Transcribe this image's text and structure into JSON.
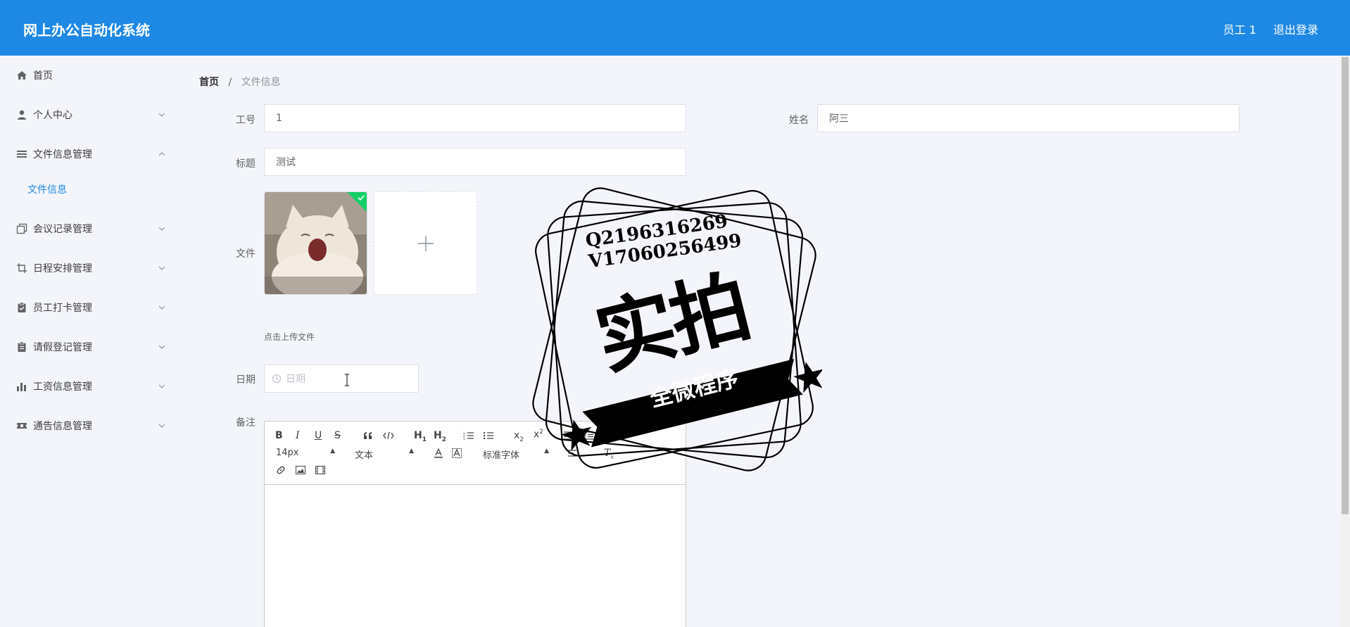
{
  "header": {
    "app_title": "网上办公自动化系统",
    "user_label": "员工 1",
    "logout_label": "退出登录"
  },
  "sidebar": {
    "items": [
      {
        "label": "首页",
        "icon": "home-icon",
        "expandable": false
      },
      {
        "label": "个人中心",
        "icon": "user-icon",
        "expandable": true
      },
      {
        "label": "文件信息管理",
        "icon": "list-icon",
        "expandable": true,
        "expanded": true
      },
      {
        "label": "会议记录管理",
        "icon": "copy-icon",
        "expandable": true
      },
      {
        "label": "日程安排管理",
        "icon": "crop-icon",
        "expandable": true
      },
      {
        "label": "员工打卡管理",
        "icon": "clipboard-check-icon",
        "expandable": true
      },
      {
        "label": "请假登记管理",
        "icon": "clipboard-icon",
        "expandable": true
      },
      {
        "label": "工资信息管理",
        "icon": "bar-chart-icon",
        "expandable": true
      },
      {
        "label": "通告信息管理",
        "icon": "ticket-icon",
        "expandable": true
      }
    ],
    "subitems": {
      "file_info": "文件信息"
    }
  },
  "breadcrumb": {
    "home": "首页",
    "separator": "/",
    "current": "文件信息"
  },
  "form": {
    "employee_id_label": "工号",
    "employee_id_value": "1",
    "name_label": "姓名",
    "name_value": "阿三",
    "title_label": "标题",
    "title_value": "测试",
    "file_label": "文件",
    "upload_tip": "点击上传文件",
    "date_label": "日期",
    "date_placeholder": "日期",
    "remark_label": "备注"
  },
  "editor_toolbar": {
    "font_size": "14px",
    "block_type": "文本",
    "font_family": "标准字体"
  },
  "watermark": {
    "line1": "Q2196316269",
    "line2": "V17060256499",
    "main_text": "实拍",
    "ribbon_text": "全微程序"
  },
  "colors": {
    "header_bg": "#1e88e5",
    "accent": "#1e88e5",
    "page_bg": "#f3f5fa",
    "upload_success": "#13ce66"
  }
}
